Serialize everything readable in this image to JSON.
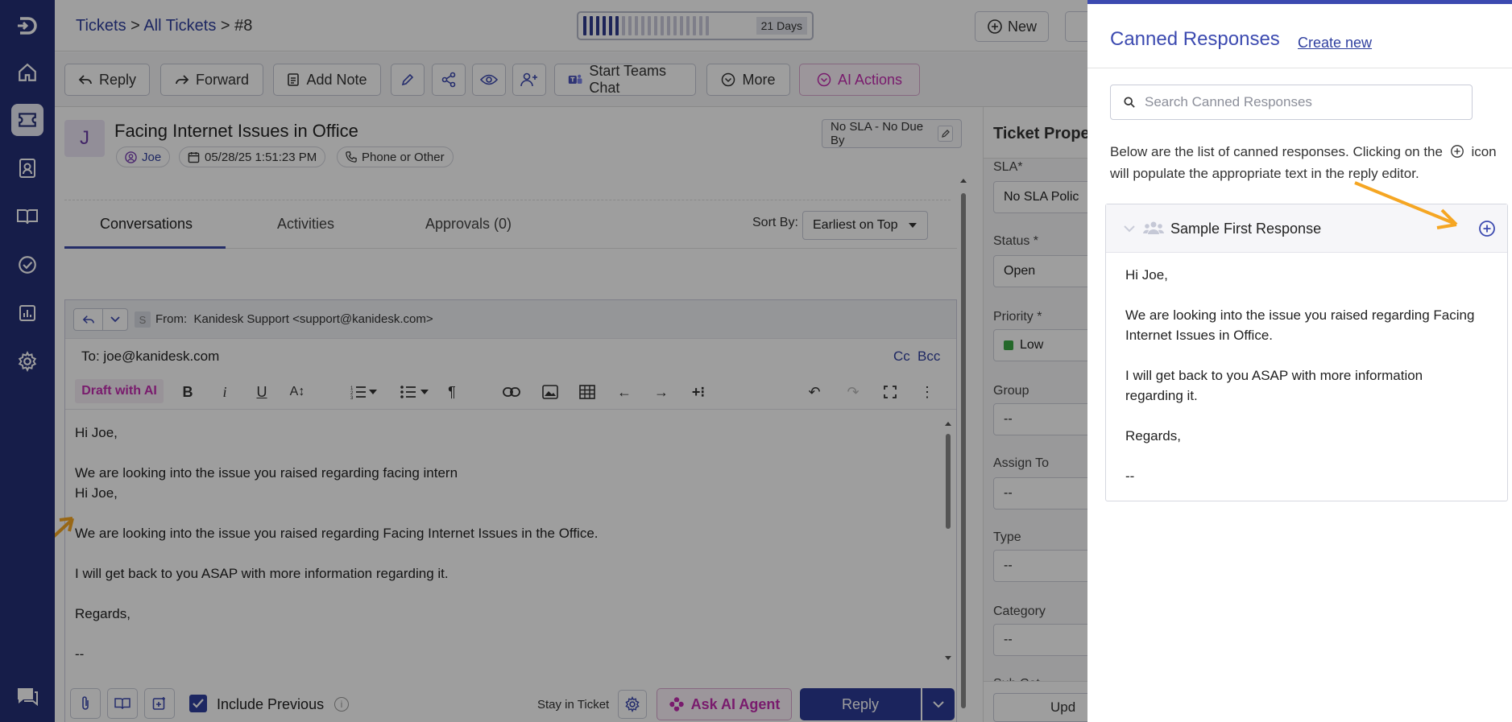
{
  "breadcrumb": {
    "tickets": "Tickets",
    "sep1": " > ",
    "all_tickets": "All Tickets",
    "sep2": " > ",
    "current": "#8"
  },
  "days_indicator": {
    "label": "21 Days"
  },
  "header_buttons": {
    "new": "New"
  },
  "toolbar": {
    "reply": "Reply",
    "forward": "Forward",
    "add_note": "Add Note",
    "start_teams_chat": "Start Teams Chat",
    "more": "More",
    "ai_actions": "AI Actions"
  },
  "ticket": {
    "avatar_letter": "J",
    "title": "Facing Internet Issues in Office",
    "requester": "Joe",
    "created": "05/28/25 1:51:23 PM",
    "source": "Phone or Other",
    "sla": "No SLA - No Due By"
  },
  "tabs": [
    {
      "label": "Conversations",
      "active": true
    },
    {
      "label": "Activities",
      "active": false
    },
    {
      "label": "Approvals (0)",
      "active": false
    }
  ],
  "sort": {
    "label": "Sort By:",
    "value": "Earliest on Top"
  },
  "editor": {
    "from_avatar": "S",
    "from_label": "From:",
    "from_value": "Kanidesk Support <support@kanidesk.com>",
    "to_label": "To:",
    "to_value": "joe@kanidesk.com",
    "cc": "Cc",
    "bcc": "Bcc",
    "draft_ai": "Draft with AI",
    "body_lines": [
      "Hi Joe,",
      "",
      "We are looking into the issue you raised regarding facing intern",
      "Hi Joe,",
      "",
      "We are looking into the issue you raised regarding Facing Internet Issues in the Office.",
      "",
      "I will get back to you ASAP with more information regarding it.",
      "",
      "Regards,",
      "",
      "--"
    ],
    "include_previous": "Include Previous",
    "include_previous_checked": true,
    "stay_in_ticket": "Stay in Ticket",
    "ask_ai_agent": "Ask AI Agent",
    "reply_button": "Reply"
  },
  "properties": {
    "title": "Ticket Prope",
    "sla_label": "SLA*",
    "sla_value": "No SLA Polic",
    "status_label": "Status *",
    "status_value": "Open",
    "priority_label": "Priority *",
    "priority_value": "Low",
    "priority_color": "#3aa845",
    "group_label": "Group",
    "group_value": "--",
    "assign_label": "Assign To",
    "assign_value": "--",
    "type_label": "Type",
    "type_value": "--",
    "category_label": "Category",
    "category_value": "--",
    "subcat_label": "Sub Cat",
    "update_button": "Upd"
  },
  "canned": {
    "title": "Canned Responses",
    "create_new": "Create new",
    "search_placeholder": "Search Canned Responses",
    "desc_part1": "Below are the list of canned responses. Clicking on the",
    "desc_part2": "icon will populate the appropriate text in the reply editor.",
    "item_title": "Sample First Response",
    "item_body": [
      "Hi Joe,",
      "",
      "We are looking into the issue you raised regarding Facing Internet Issues in Office.",
      "",
      "I will get back to you ASAP with more information regarding it.",
      "",
      "Regards,",
      "",
      "--"
    ]
  },
  "colors": {
    "sidebar": "#253077",
    "accent": "#3c4ab0",
    "ai_pink": "#c42db0",
    "annotation_arrow": "#f5a623"
  }
}
